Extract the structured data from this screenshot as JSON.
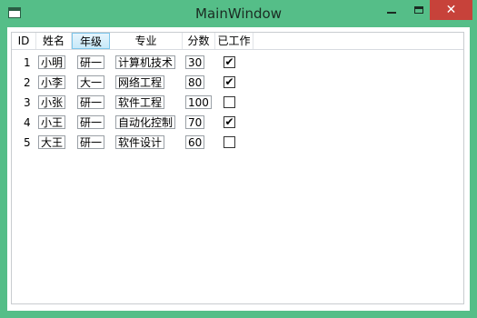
{
  "window": {
    "title": "MainWindow"
  },
  "controls": {
    "minimize": "minimize",
    "maximize": "maximize",
    "close": "✕"
  },
  "columns": [
    "ID",
    "姓名",
    "年级",
    "专业",
    "分数",
    "已工作"
  ],
  "rows": [
    {
      "id": "1",
      "name": "小明",
      "grade": "研一",
      "major": "计算机技术",
      "score": "30",
      "employed": true
    },
    {
      "id": "2",
      "name": "小李",
      "grade": "大一",
      "major": "网络工程",
      "score": "80",
      "employed": true
    },
    {
      "id": "3",
      "name": "小张",
      "grade": "研一",
      "major": "软件工程",
      "score": "100",
      "employed": false
    },
    {
      "id": "4",
      "name": "小王",
      "grade": "研一",
      "major": "自动化控制",
      "score": "70",
      "employed": true
    },
    {
      "id": "5",
      "name": "大王",
      "grade": "研一",
      "major": "软件设计",
      "score": "60",
      "employed": false
    }
  ],
  "colors": {
    "window_frame": "#55be88",
    "close_button": "#c7423a",
    "active_header": "#c8e9f9"
  }
}
